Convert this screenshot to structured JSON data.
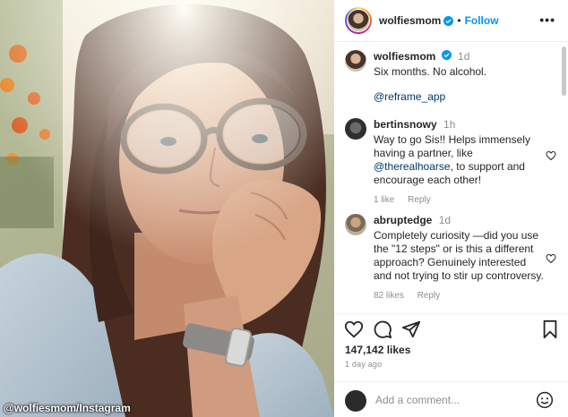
{
  "photo": {
    "credit": "@wolfiesmom/Instagram"
  },
  "header": {
    "username": "wolfiesmom",
    "separator": "•",
    "follow_label": "Follow",
    "more_label": "•••"
  },
  "caption": {
    "username": "wolfiesmom",
    "time": "1d",
    "text": "Six months. No alcohol.",
    "mention": "@reframe_app"
  },
  "comments": [
    {
      "username": "bertinsnowy",
      "time": "1h",
      "text_before": "Way to go Sis!! Helps immensely having a partner, like ",
      "mention": "@therealhoarse",
      "text_after": ", to support and encourage each other!",
      "likes": "1 like",
      "reply": "Reply"
    },
    {
      "username": "abruptedge",
      "time": "1d",
      "text": "Completely curiosity —did you use the \"12 steps\" or is this a different approach? Genuinely interested and not trying to stir up controversy.",
      "likes": "82 likes",
      "reply": "Reply"
    }
  ],
  "actions": {
    "icons": [
      "heart-icon",
      "comment-icon",
      "share-icon",
      "bookmark-icon"
    ],
    "likes": "147,142 likes",
    "date": "1 day ago"
  },
  "add_comment": {
    "placeholder": "Add a comment...",
    "icon": "emoji-icon"
  },
  "colors": {
    "accent": "#0095f6",
    "mention": "#00376b",
    "muted": "#8e8e8e",
    "text": "#262626"
  }
}
